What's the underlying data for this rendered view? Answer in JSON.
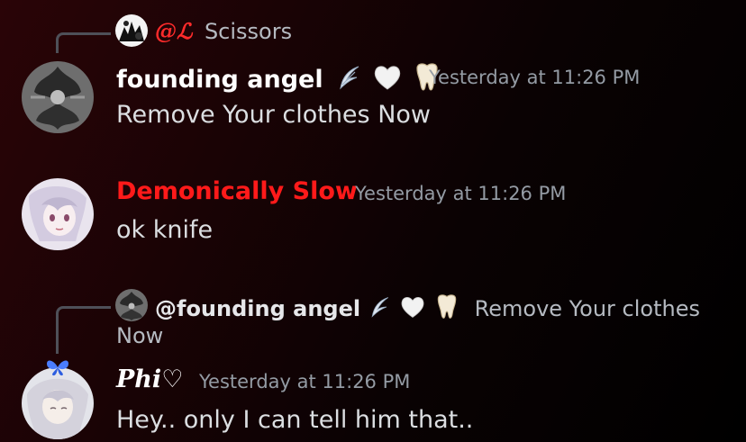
{
  "messages": [
    {
      "reply": {
        "mention": "@ℒ",
        "text": "Scissors"
      },
      "author": "founding angel",
      "author_emojis": [
        "feather-emoji",
        "white-heart-emoji",
        "tooth-emoji"
      ],
      "timestamp": "Yesterday at 11:26 PM",
      "content": "Remove Your clothes Now"
    },
    {
      "author": "Demonically Slow",
      "author_color": "#ff1a1a",
      "timestamp": "Yesterday at 11:26 PM",
      "content": "ok knife"
    },
    {
      "reply": {
        "mention": "@founding angel",
        "text_line1": "Remove Your clothes",
        "text_line2": "Now"
      },
      "author": "Phi♡",
      "timestamp": "Yesterday at 11:26 PM",
      "content": "Hey.. only I can tell him that.."
    }
  ],
  "colors": {
    "mention_red": "#ff2b2b",
    "timestamp": "#949ba4",
    "reply_line": "#4e5058",
    "text": "#dbdee1"
  }
}
